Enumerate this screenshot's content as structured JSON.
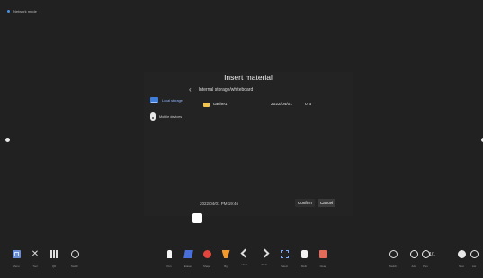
{
  "status": {
    "label": "Network mode"
  },
  "dialog": {
    "title": "Insert material",
    "path": "Internal storage/whiteboard",
    "sources": [
      {
        "label": "Local storage",
        "icon": "folder-storage-icon",
        "selected": true
      },
      {
        "label": "Mobile devices",
        "icon": "mobile-device-icon",
        "selected": false
      }
    ],
    "files": [
      {
        "name": "cache1",
        "date": "2022/04/01",
        "size": "0 B"
      }
    ],
    "footer_time": "2022/04/01 PM 19:46",
    "confirm_label": "Confirm",
    "cancel_label": "Cancel"
  },
  "toolbar": {
    "left": [
      {
        "label": "Menu",
        "icon": "menu-icon"
      },
      {
        "label": "Tool",
        "icon": "tools-icon"
      },
      {
        "label": "QR",
        "icon": "qr-icon"
      },
      {
        "label": "Switch",
        "icon": "switch-icon"
      }
    ],
    "center": [
      {
        "label": "Pen",
        "icon": "pen-icon"
      },
      {
        "label": "Eraser",
        "icon": "eraser-icon"
      },
      {
        "label": "Shape",
        "icon": "shape-icon"
      },
      {
        "label": "Bg",
        "icon": "background-icon"
      },
      {
        "label": "Undo",
        "icon": "undo-icon"
      },
      {
        "label": "Redo",
        "icon": "redo-icon"
      },
      {
        "label": "Select",
        "icon": "select-icon"
      },
      {
        "label": "Multi",
        "icon": "multi-touch-icon"
      },
      {
        "label": "Clear",
        "icon": "clear-icon"
      }
    ],
    "right": [
      {
        "label": "Switch",
        "icon": "switch-icon"
      },
      {
        "label": "Add",
        "icon": "add-page-icon"
      },
      {
        "label": "Prev",
        "icon": "prev-page-icon"
      },
      {
        "label": "Next",
        "icon": "next-page-icon"
      },
      {
        "label": "List",
        "icon": "page-list-icon"
      }
    ],
    "page_counter": "1/1"
  }
}
